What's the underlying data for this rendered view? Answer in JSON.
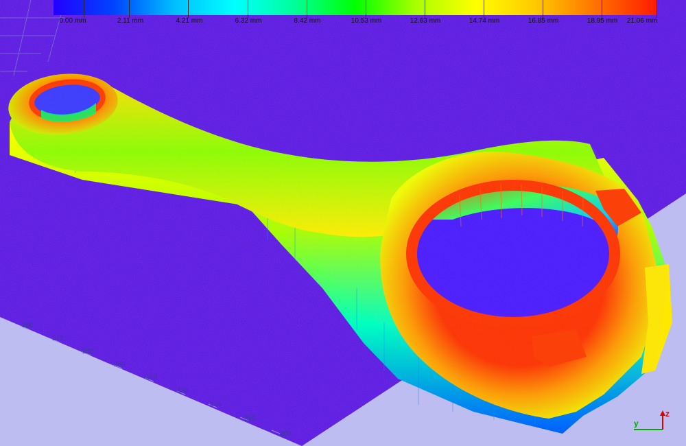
{
  "color_scale": {
    "ticks": [
      "0.00 mm",
      "2.11 mm",
      "4.21 mm",
      "6.32 mm",
      "8.42 mm",
      "10.53 mm",
      "12.63 mm",
      "14.74 mm",
      "16.85 mm",
      "18.95 mm",
      "21.06 mm"
    ],
    "min": 0.0,
    "max": 21.06,
    "unit": "mm"
  },
  "ruler_labels": [
    "280",
    "270",
    "260",
    "250",
    "240",
    "230",
    "220",
    "210",
    "200"
  ],
  "axes_widget": {
    "y_label": "y",
    "z_label": "z"
  },
  "colors": {
    "background": "#bdbdf2",
    "plate": "#5a14e6",
    "low": "#2200ff",
    "high": "#ff1a00"
  }
}
